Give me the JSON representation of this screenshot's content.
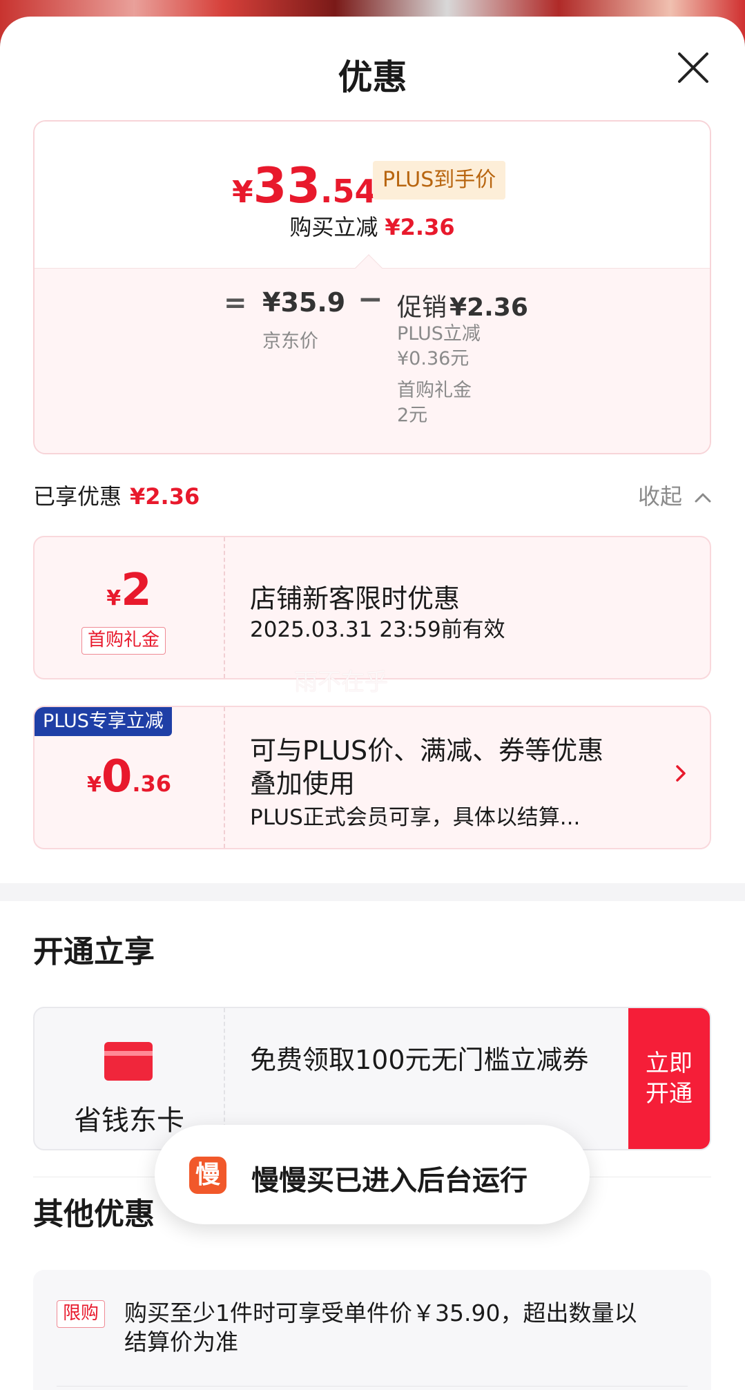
{
  "header": {
    "title": "优惠"
  },
  "price_card": {
    "currency": "¥",
    "price_int": "33",
    "price_dec": ".54",
    "plus_tag": "PLUS到手价",
    "reduce_label": "购买立减",
    "reduce_amount": "¥2.36",
    "equals": "=",
    "jd_price": "¥35.9",
    "jd_label": "京东价",
    "minus": "−",
    "promo_label": "促销",
    "promo_amount": "¥2.36",
    "promo_items": [
      {
        "name": "PLUS立减",
        "value": "¥0.36元"
      },
      {
        "name": "首购礼金",
        "value": "2元"
      }
    ]
  },
  "enjoyed": {
    "label": "已享优惠",
    "amount": "¥2.36",
    "collapse": "收起"
  },
  "coupons": [
    {
      "currency": "¥",
      "amount_int": "2",
      "amount_dec": "",
      "tag": "首购礼金",
      "title": "店铺新客限时优惠",
      "subtitle": "2025.03.31 23:59前有效"
    },
    {
      "badge": "PLUS专享立减",
      "currency": "¥",
      "amount_int": "0",
      "amount_dec": ".36",
      "title_line1": "可与PLUS价、满减、券等优惠",
      "title_line2": "叠加使用",
      "subtitle": "PLUS正式会员可享，具体以结算..."
    }
  ],
  "watermark": "雨不在乎",
  "open_section": {
    "title": "开通立享",
    "card_label": "省钱东卡",
    "description": "免费领取100元无门槛立减券",
    "button_line1": "立即",
    "button_line2": "开通"
  },
  "other_section": {
    "title": "其他优惠",
    "limit_tag": "限购",
    "limit_text": "购买至少1件时可享受单件价￥35.90，超出数量以结算价为准"
  },
  "toast": {
    "icon_char": "慢",
    "text": "慢慢买已进入后台运行"
  },
  "colors": {
    "accent_red": "#e8192c",
    "plus_blue": "#1f3fa6",
    "button_red": "#f51e38",
    "toast_icon": "#f1582a"
  }
}
